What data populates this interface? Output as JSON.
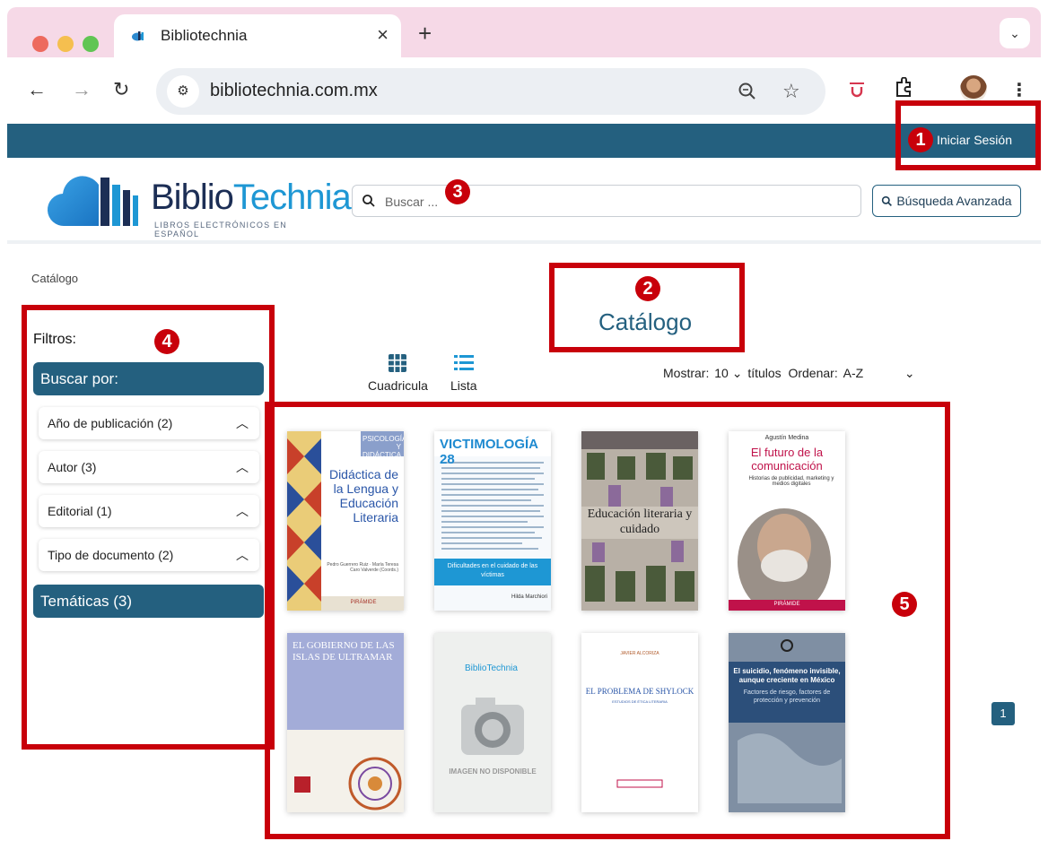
{
  "browser": {
    "tab_title": "Bibliotechnia",
    "tab_close": "×",
    "new_tab": "+",
    "url": "bibliotechnia.com.mx",
    "tab_menu": "⌄",
    "icons": [
      "back-icon",
      "forward-icon",
      "reload-icon",
      "site-info-icon",
      "zoom-icon",
      "bookmark-star-icon",
      "extension-icon",
      "puzzle-icon",
      "avatar",
      "more-menu-icon"
    ]
  },
  "site": {
    "login_label": "Iniciar Sesión",
    "logo_main_left": "Biblio",
    "logo_main_right": "Technia",
    "logo_sub": "LIBROS ELECTRÓNICOS EN ESPAÑOL",
    "search_placeholder": "Buscar ...",
    "advanced_search_label": "Búsqueda Avanzada",
    "breadcrumb": "Catálogo",
    "page_title": "Catálogo",
    "brand_color": "#24607f"
  },
  "sidebar": {
    "filters_label": "Filtros:",
    "search_by_label": "Buscar por:",
    "facets": [
      {
        "label": "Año de publicación (2)"
      },
      {
        "label": "Autor (3)"
      },
      {
        "label": "Editorial (1)"
      },
      {
        "label": "Tipo de documento (2)"
      }
    ],
    "topics_label": "Temáticas (3)"
  },
  "view": {
    "grid_label": "Cuadricula",
    "list_label": "Lista",
    "show_label": "Mostrar:",
    "show_value": "10",
    "titles_label": "títulos",
    "sort_label": "Ordenar:",
    "sort_value": "A-Z"
  },
  "books": [
    {
      "title": "Didáctica de la Lengua y Educación Literaria",
      "tag": "PSICOLOGÍA Y DIDÁCTICA",
      "authors": "Pedro Guerrero Ruiz · María Teresa Caro Valverde (Coords.)",
      "publisher": "PIRÁMIDE"
    },
    {
      "title": "VICTIMOLOGÍA 28",
      "subtitle": "Dificultades en el cuidado de las víctimas",
      "author": "Hilda Marchiori"
    },
    {
      "title": "Educación literaria y cuidado"
    },
    {
      "author": "Agustín Medina",
      "title": "El futuro de la comunicación",
      "subtitle": "Historias de publicidad, marketing y medios digitales",
      "publisher": "PIRÁMIDE"
    },
    {
      "title": "EL GOBIERNO DE LAS ISLAS DE ULTRAMAR"
    },
    {
      "title": "BiblioTechnia",
      "subtitle": "IMAGEN NO DISPONIBLE"
    },
    {
      "author": "JAVIER ALCORIZA",
      "title": "EL PROBLEMA DE SHYLOCK",
      "subtitle": "ESTUDIOS DE ÉTICA LITERARIA"
    },
    {
      "title": "El suicidio, fenómeno invisible, aunque creciente en México",
      "subtitle": "Factores de riesgo, factores de protección y prevención"
    }
  ],
  "pagination": {
    "current": "1"
  },
  "annotations": [
    "1",
    "2",
    "3",
    "4",
    "5"
  ]
}
